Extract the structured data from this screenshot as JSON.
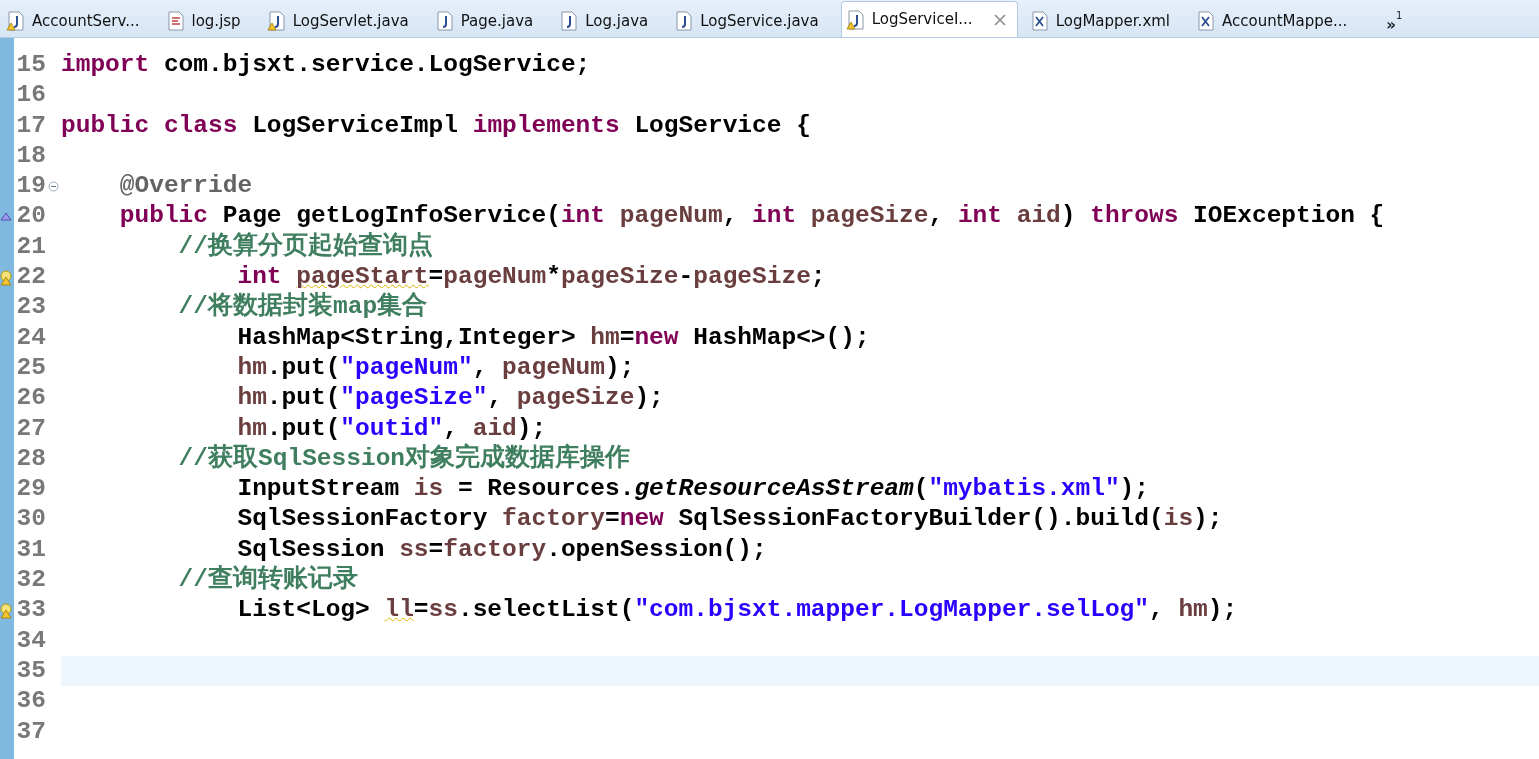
{
  "tabs": [
    {
      "label": "AccountServ...",
      "kind": "java",
      "warning": true,
      "selected": false
    },
    {
      "label": "log.jsp",
      "kind": "jsp",
      "warning": false,
      "selected": false
    },
    {
      "label": "LogServlet.java",
      "kind": "java",
      "warning": true,
      "selected": false
    },
    {
      "label": "Page.java",
      "kind": "java",
      "warning": false,
      "selected": false
    },
    {
      "label": "Log.java",
      "kind": "java",
      "warning": false,
      "selected": false
    },
    {
      "label": "LogService.java",
      "kind": "java",
      "warning": false,
      "selected": false
    },
    {
      "label": "LogServiceI...",
      "kind": "java",
      "warning": true,
      "selected": true
    },
    {
      "label": "LogMapper.xml",
      "kind": "xml",
      "warning": false,
      "selected": false
    },
    {
      "label": "AccountMappe...",
      "kind": "xml",
      "warning": false,
      "selected": false
    }
  ],
  "tab_overflow": {
    "label": "»",
    "count": "1"
  },
  "editor": {
    "lines": [
      {
        "number": "15",
        "segments": [
          {
            "kind": "keyword",
            "text": "import"
          },
          {
            "kind": "plain",
            "text": " com.bjsxt.service.LogService;"
          }
        ]
      },
      {
        "number": "16"
      },
      {
        "number": "17",
        "segments": [
          {
            "kind": "keyword",
            "text": "public class"
          },
          {
            "kind": "plain",
            "text": " LogServiceImpl "
          },
          {
            "kind": "keyword",
            "text": "implements"
          },
          {
            "kind": "plain",
            "text": " LogService {"
          }
        ]
      },
      {
        "number": "18"
      },
      {
        "number": "19",
        "gutter": {
          "kind": "fold"
        },
        "segments": [
          {
            "kind": "annotation",
            "text": "    @Override"
          }
        ]
      },
      {
        "number": "20",
        "gutter": {
          "kind": "override"
        },
        "segments": [
          {
            "kind": "keyword",
            "text": "    public"
          },
          {
            "kind": "plain",
            "text": " Page getLogInfoService("
          },
          {
            "kind": "keyword",
            "text": "int"
          },
          {
            "kind": "local",
            "text": " pageNum"
          },
          {
            "kind": "plain",
            "text": ", "
          },
          {
            "kind": "keyword",
            "text": "int"
          },
          {
            "kind": "local",
            "text": " pageSize"
          },
          {
            "kind": "plain",
            "text": ", "
          },
          {
            "kind": "keyword",
            "text": "int"
          },
          {
            "kind": "local",
            "text": " aid"
          },
          {
            "kind": "plain",
            "text": ") "
          },
          {
            "kind": "keyword",
            "text": "throws"
          },
          {
            "kind": "plain",
            "text": " IOException {"
          }
        ]
      },
      {
        "number": "21",
        "segments": [
          {
            "kind": "comment",
            "text": "        //换算分页起始查询点"
          }
        ]
      },
      {
        "number": "22",
        "gutter": {
          "kind": "warning"
        },
        "segments": [
          {
            "kind": "keyword",
            "text": "            int "
          },
          {
            "kind": "local",
            "text": "pageStart",
            "warning": true
          },
          {
            "kind": "plain",
            "text": "="
          },
          {
            "kind": "local",
            "text": "pageNum"
          },
          {
            "kind": "plain",
            "text": "*"
          },
          {
            "kind": "local",
            "text": "pageSize"
          },
          {
            "kind": "plain",
            "text": "-"
          },
          {
            "kind": "local",
            "text": "pageSize"
          },
          {
            "kind": "plain",
            "text": ";"
          }
        ]
      },
      {
        "number": "23",
        "segments": [
          {
            "kind": "comment",
            "text": "        //将数据封装map集合"
          }
        ]
      },
      {
        "number": "24",
        "segments": [
          {
            "kind": "plain",
            "text": "            HashMap<String,Integer> "
          },
          {
            "kind": "local",
            "text": "hm"
          },
          {
            "kind": "plain",
            "text": "="
          },
          {
            "kind": "keyword",
            "text": "new"
          },
          {
            "kind": "plain",
            "text": " HashMap<>();"
          }
        ]
      },
      {
        "number": "25",
        "segments": [
          {
            "kind": "local",
            "text": "            hm"
          },
          {
            "kind": "plain",
            "text": ".put("
          },
          {
            "kind": "string",
            "text": "\"pageNum\""
          },
          {
            "kind": "plain",
            "text": ", "
          },
          {
            "kind": "local",
            "text": "pageNum"
          },
          {
            "kind": "plain",
            "text": ");"
          }
        ]
      },
      {
        "number": "26",
        "segments": [
          {
            "kind": "local",
            "text": "            hm"
          },
          {
            "kind": "plain",
            "text": ".put("
          },
          {
            "kind": "string",
            "text": "\"pageSize\""
          },
          {
            "kind": "plain",
            "text": ", "
          },
          {
            "kind": "local",
            "text": "pageSize"
          },
          {
            "kind": "plain",
            "text": ");"
          }
        ]
      },
      {
        "number": "27",
        "segments": [
          {
            "kind": "local",
            "text": "            hm"
          },
          {
            "kind": "plain",
            "text": ".put("
          },
          {
            "kind": "string",
            "text": "\"outid\""
          },
          {
            "kind": "plain",
            "text": ", "
          },
          {
            "kind": "local",
            "text": "aid"
          },
          {
            "kind": "plain",
            "text": ");"
          }
        ]
      },
      {
        "number": "28",
        "segments": [
          {
            "kind": "comment",
            "text": "        //获取SqlSession对象完成数据库操作"
          }
        ]
      },
      {
        "number": "29",
        "segments": [
          {
            "kind": "plain",
            "text": "            InputStream "
          },
          {
            "kind": "local",
            "text": "is"
          },
          {
            "kind": "plain",
            "text": " = Resources."
          },
          {
            "kind": "static",
            "text": "getResourceAsStream"
          },
          {
            "kind": "plain",
            "text": "("
          },
          {
            "kind": "string",
            "text": "\"mybatis.xml\""
          },
          {
            "kind": "plain",
            "text": ");"
          }
        ]
      },
      {
        "number": "30",
        "segments": [
          {
            "kind": "plain",
            "text": "            SqlSessionFactory "
          },
          {
            "kind": "local",
            "text": "factory"
          },
          {
            "kind": "plain",
            "text": "="
          },
          {
            "kind": "keyword",
            "text": "new"
          },
          {
            "kind": "plain",
            "text": " SqlSessionFactoryBuilder().build("
          },
          {
            "kind": "local",
            "text": "is"
          },
          {
            "kind": "plain",
            "text": ");"
          }
        ]
      },
      {
        "number": "31",
        "segments": [
          {
            "kind": "plain",
            "text": "            SqlSession "
          },
          {
            "kind": "local",
            "text": "ss"
          },
          {
            "kind": "plain",
            "text": "="
          },
          {
            "kind": "local",
            "text": "factory"
          },
          {
            "kind": "plain",
            "text": ".openSession();"
          }
        ]
      },
      {
        "number": "32",
        "segments": [
          {
            "kind": "comment",
            "text": "        //查询转账记录"
          }
        ]
      },
      {
        "number": "33",
        "gutter": {
          "kind": "warning"
        },
        "segments": [
          {
            "kind": "plain",
            "text": "            List<Log> "
          },
          {
            "kind": "local",
            "text": "ll",
            "warning": true
          },
          {
            "kind": "plain",
            "text": "="
          },
          {
            "kind": "local",
            "text": "ss"
          },
          {
            "kind": "plain",
            "text": ".selectList("
          },
          {
            "kind": "string",
            "text": "\"com.bjsxt.mapper.LogMapper.selLog\""
          },
          {
            "kind": "plain",
            "text": ", "
          },
          {
            "kind": "local",
            "text": "hm"
          },
          {
            "kind": "plain",
            "text": ");"
          }
        ]
      },
      {
        "number": "34"
      },
      {
        "number": "35",
        "current": true
      },
      {
        "number": "36"
      },
      {
        "number": "37"
      }
    ]
  }
}
